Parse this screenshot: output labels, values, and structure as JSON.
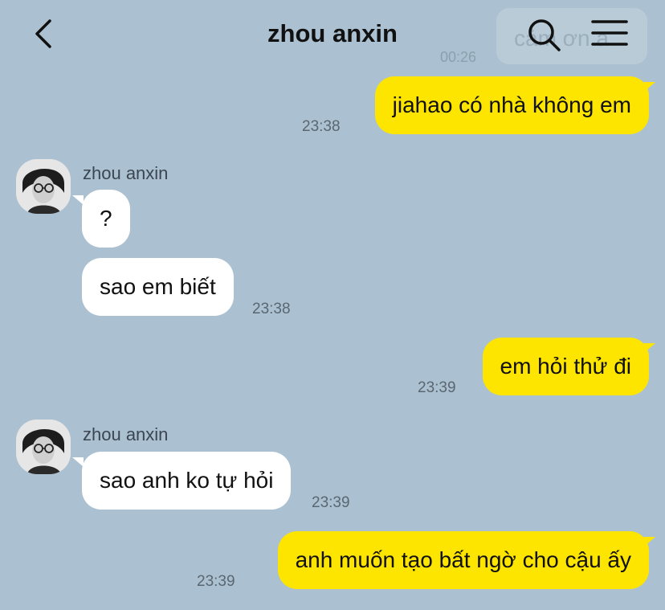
{
  "header": {
    "title": "zhou anxin",
    "ghost_text": "cảm ơn a",
    "ghost_time": "00:26"
  },
  "icons": {
    "back": "chevron-left-icon",
    "search": "search-icon",
    "menu": "hamburger-menu-icon"
  },
  "colors": {
    "background": "#abc1d1",
    "outgoing_bubble": "#fee500",
    "incoming_bubble": "#ffffff"
  },
  "messages": [
    {
      "direction": "out",
      "text": "jiahao có nhà không em",
      "time": "23:38"
    },
    {
      "direction": "in",
      "sender": "zhou anxin",
      "text": "?"
    },
    {
      "direction": "in",
      "text": "sao em biết",
      "time": "23:38"
    },
    {
      "direction": "out",
      "text": "em hỏi thử đi",
      "time": "23:39"
    },
    {
      "direction": "in",
      "sender": "zhou anxin",
      "text": "sao anh ko tự hỏi",
      "time": "23:39"
    },
    {
      "direction": "out",
      "text": "anh muốn tạo bất ngờ cho cậu ấy",
      "time": "23:39"
    }
  ]
}
